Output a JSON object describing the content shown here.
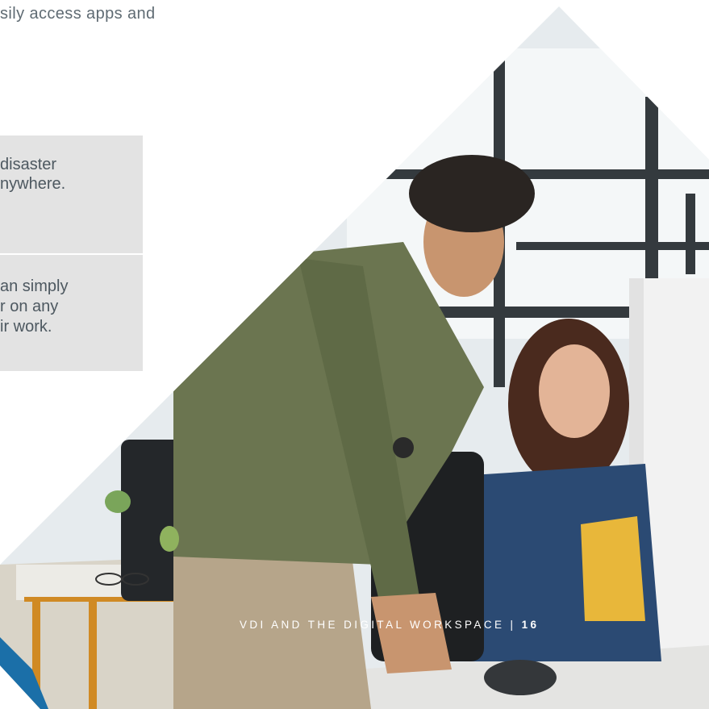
{
  "intro": {
    "text": "sily access apps and"
  },
  "callouts": [
    {
      "lines": [
        "disaster",
        "nywhere."
      ]
    },
    {
      "lines": [
        "an simply",
        "r on any",
        "ir work."
      ]
    }
  ],
  "photo": {
    "subject": "photo-two-coworkers-at-computer"
  },
  "footer": {
    "title": "VDI AND THE DIGITAL WORKSPACE |",
    "page_number": "16"
  },
  "colors": {
    "callout_bg": "#e3e3e3",
    "body_text": "#4d5860",
    "footer_text": "#ffffff"
  }
}
